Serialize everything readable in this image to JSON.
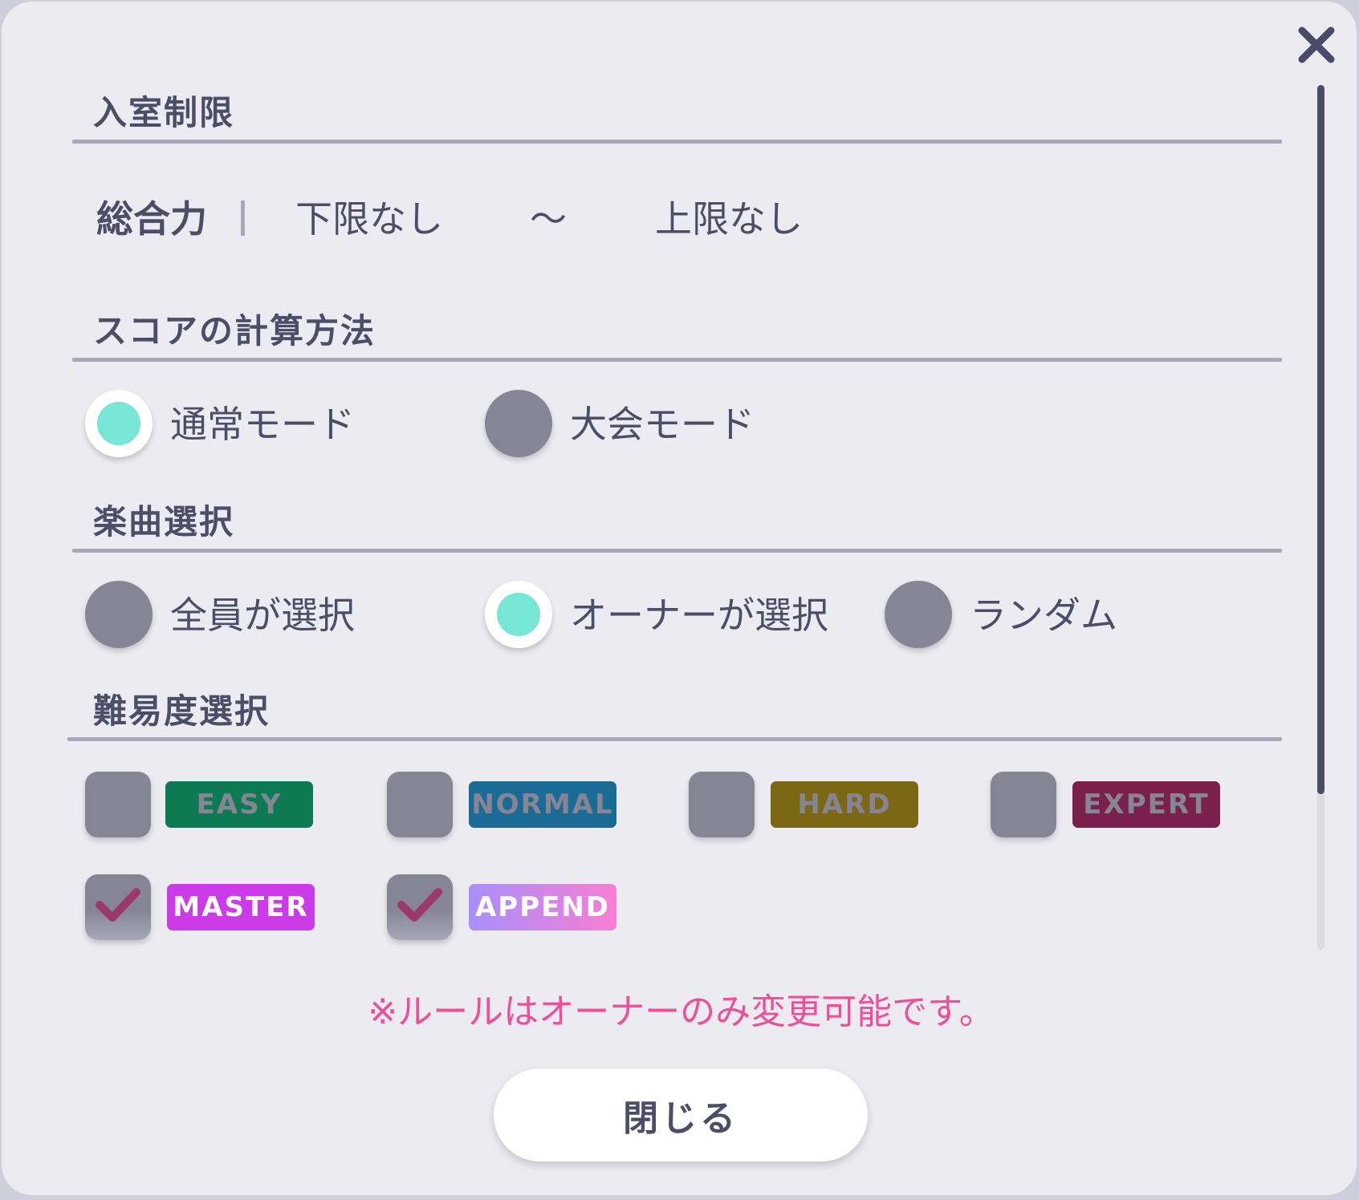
{
  "sections": {
    "entry_limit": {
      "title": "入室制限",
      "power_label": "総合力",
      "lower": "下限なし",
      "tilde": "～",
      "upper": "上限なし"
    },
    "score_method": {
      "title": "スコアの計算方法",
      "options": [
        {
          "label": "通常モード",
          "selected": true
        },
        {
          "label": "大会モード",
          "selected": false
        }
      ]
    },
    "song_select": {
      "title": "楽曲選択",
      "options": [
        {
          "label": "全員が選択",
          "selected": false
        },
        {
          "label": "オーナーが選択",
          "selected": true
        },
        {
          "label": "ランダム",
          "selected": false
        }
      ]
    },
    "difficulty": {
      "title": "難易度選択",
      "items": [
        {
          "label": "EASY",
          "checked": false,
          "color": "#0e7a53"
        },
        {
          "label": "NORMAL",
          "checked": false,
          "color": "#1a6b95"
        },
        {
          "label": "HARD",
          "checked": false,
          "color": "#7c6714"
        },
        {
          "label": "EXPERT",
          "checked": false,
          "color": "#7b1f4b"
        },
        {
          "label": "MASTER",
          "checked": true,
          "color": "#cc3be8"
        },
        {
          "label": "APPEND",
          "checked": true,
          "color_from": "#a98ffb",
          "color_to": "#f77ed4"
        }
      ]
    }
  },
  "note": "※ルールはオーナーのみ変更可能です。",
  "close_button_label": "閉じる",
  "icons": {
    "close": "close-x-icon",
    "check": "checkmark-icon"
  },
  "colors": {
    "accent": "#77e6d4",
    "note": "#ee4f97",
    "check": "#9b3a66",
    "text": "#4c4d66"
  }
}
